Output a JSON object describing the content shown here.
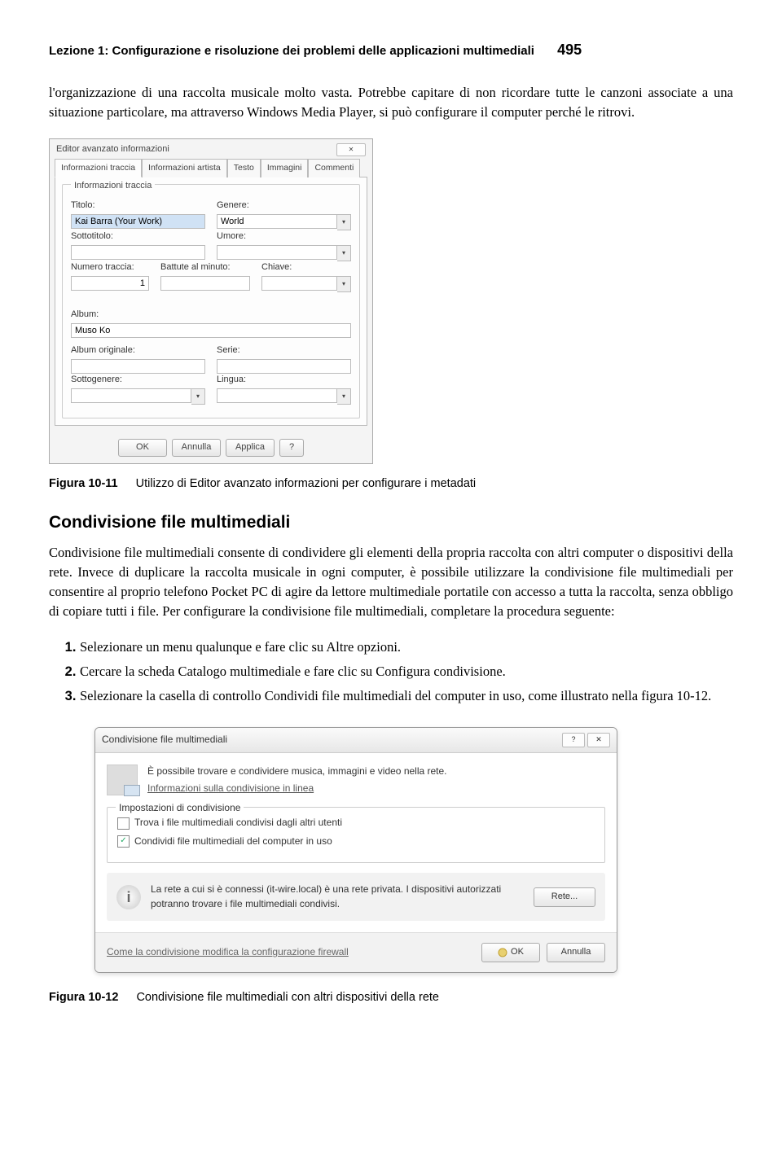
{
  "header": {
    "title": "Lezione 1: Configurazione e risoluzione dei problemi delle applicazioni multimediali",
    "pagenum": "495"
  },
  "intro": "l'organizzazione di una raccolta musicale molto vasta. Potrebbe capitare di non ricordare tutte le canzoni associate a una situazione particolare, ma attraverso Windows Media Player, si può configurare il computer perché le ritrovi.",
  "dialog1": {
    "title": "Editor avanzato informazioni",
    "tabs": [
      "Informazioni traccia",
      "Informazioni artista",
      "Testo",
      "Immagini",
      "Commenti"
    ],
    "group": "Informazioni traccia",
    "labels": {
      "titolo": "Titolo:",
      "genere": "Genere:",
      "sottotitolo": "Sottotitolo:",
      "umore": "Umore:",
      "numero": "Numero traccia:",
      "battute": "Battute al minuto:",
      "chiave": "Chiave:",
      "album": "Album:",
      "albumorig": "Album originale:",
      "serie": "Serie:",
      "sottogenere": "Sottogenere:",
      "lingua": "Lingua:"
    },
    "values": {
      "titolo": "Kai Barra (Your Work)",
      "genere": "World",
      "numero": "1",
      "album": "Muso Ko"
    },
    "buttons": {
      "ok": "OK",
      "annulla": "Annulla",
      "applica": "Applica",
      "help": "?"
    }
  },
  "cap1": {
    "label": "Figura 10-11",
    "text": "Utilizzo di Editor avanzato informazioni per configurare i metadati"
  },
  "section": "Condivisione file multimediali",
  "sectionbody": "Condivisione file multimediali consente di condividere gli elementi della propria raccolta con altri computer o dispositivi della rete. Invece di duplicare la raccolta musicale in ogni computer, è possibile utilizzare la condivisione file multimediali per consentire al proprio telefono Pocket PC di agire da lettore multimediale portatile con accesso a tutta la raccolta, senza obbligo di copiare tutti i file. Per configurare la condivisione file multimediali, completare la procedura seguente:",
  "steps": [
    "Selezionare un menu qualunque e fare clic su Altre opzioni.",
    "Cercare la scheda Catalogo multimediale e fare clic su Configura condivisione.",
    "Selezionare la casella di controllo Condividi file multimediali del computer in uso, come illustrato nella figura 10-12."
  ],
  "dialog2": {
    "title": "Condivisione file multimediali",
    "toptext": "È possibile trovare e condividere musica, immagini e video nella rete.",
    "toplink": "Informazioni sulla condivisione in linea",
    "group": "Impostazioni di condivisione",
    "chk1": "Trova i file multimediali condivisi dagli altri utenti",
    "chk2": "Condividi file multimediali del computer in uso",
    "info": "La rete a cui si è connessi (it-wire.local) è una rete privata. I dispositivi autorizzati potranno trovare i file multimediali condivisi.",
    "rete": "Rete...",
    "bottomlink": "Come la condivisione modifica la configurazione firewall",
    "ok": "OK",
    "annulla": "Annulla"
  },
  "cap2": {
    "label": "Figura 10-12",
    "text": "Condivisione file multimediali con altri dispositivi della rete"
  }
}
